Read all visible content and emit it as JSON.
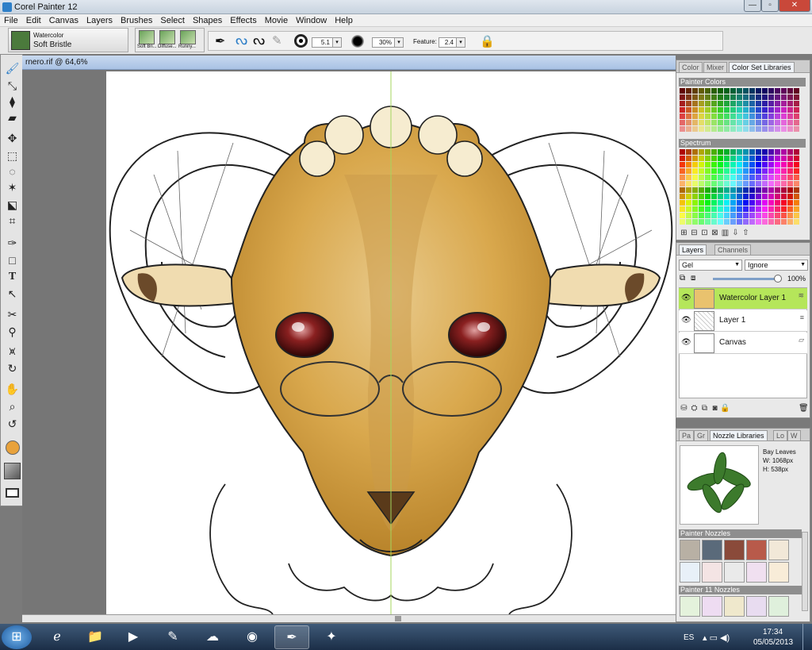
{
  "window": {
    "title": "Corel Painter 12",
    "minimize": "—",
    "maximize": "▫",
    "close": "✕"
  },
  "menu": [
    "File",
    "Edit",
    "Canvas",
    "Layers",
    "Brushes",
    "Select",
    "Shapes",
    "Effects",
    "Movie",
    "Window",
    "Help"
  ],
  "brush": {
    "category": "Watercolor",
    "variant": "Soft Bristle"
  },
  "recent_brushes": [
    "Soft Bri...",
    "Diffuse...",
    "Runny..."
  ],
  "property_bar": {
    "size": "5.1",
    "opacity": "30%",
    "feature_label": "Feature:",
    "feature": "2.4"
  },
  "document": {
    "tab_title": "rnero.rif @ 64,6%"
  },
  "color_panel": {
    "tabs": [
      "Color",
      "Mixer",
      "Color Set Libraries"
    ],
    "painter_colors_label": "Painter Colors",
    "spectrum_label": "Spectrum"
  },
  "layers_panel": {
    "tabs": [
      "Layers",
      "Channels"
    ],
    "composite_method": "Gel",
    "composite_depth": "Ignore",
    "opacity": "100%",
    "layers": [
      {
        "name": "Watercolor Layer 1",
        "selected": true
      },
      {
        "name": "Layer 1",
        "selected": false
      },
      {
        "name": "Canvas",
        "selected": false
      }
    ]
  },
  "nozzle_panel": {
    "tabs": [
      "Pa",
      "Gr",
      "Nozzle Libraries",
      "Lo",
      "W"
    ],
    "preview_name": "Bay Leaves",
    "preview_width": "W: 1068px",
    "preview_height": "H: 538px",
    "painter_nozzles_label": "Painter Nozzles",
    "painter11_nozzles_label": "Painter 11 Nozzles"
  },
  "taskbar": {
    "language": "ES",
    "time": "17:34",
    "date": "05/05/2013"
  },
  "colors": {
    "selection_green": "#b5e65a",
    "current_color": "#e8a23c",
    "accent_blue": "#2e7fc8"
  }
}
